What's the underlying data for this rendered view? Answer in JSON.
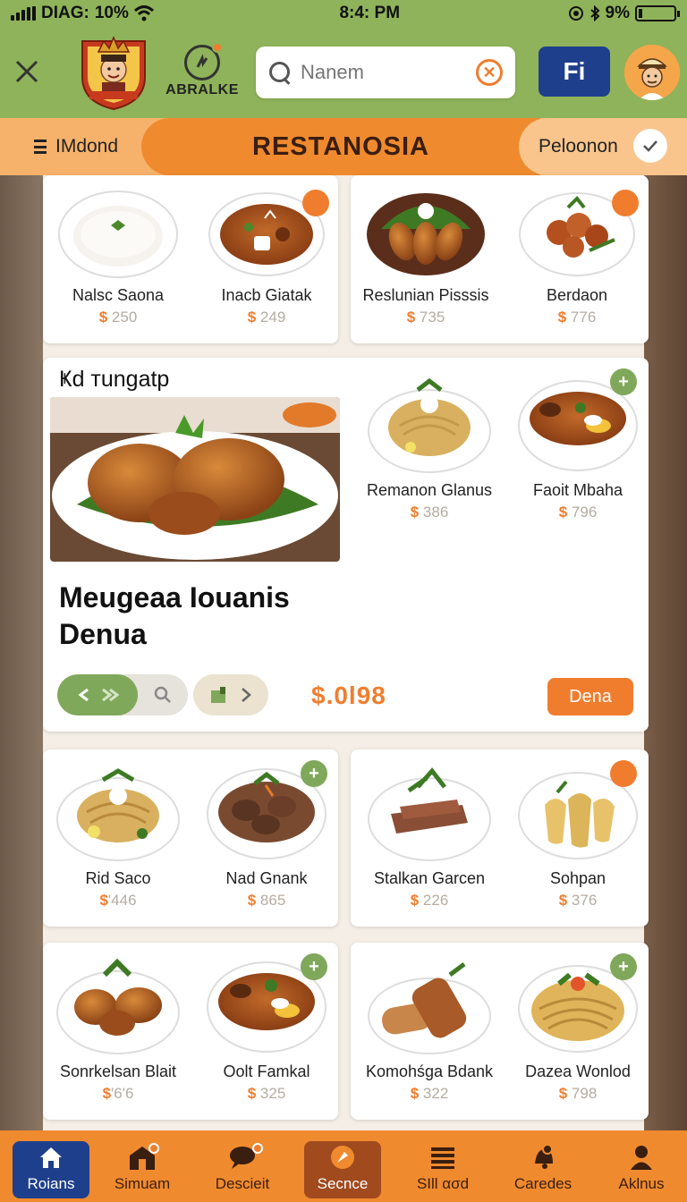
{
  "status_bar": {
    "carrier": "DIAG:",
    "signal_percent": "10%",
    "time": "8:4: PM",
    "battery": "9%"
  },
  "header": {
    "brand_name": "ABRALKE",
    "search": {
      "placeholder": "Nanem",
      "value": ""
    },
    "fi_button": "Fi"
  },
  "titlebar": {
    "menu_label": "IMdond",
    "title": "RESTANOSIA",
    "location_label": "Peloonon"
  },
  "top_row": [
    {
      "name": "Nalsc Saona",
      "currency": "$",
      "price": "250"
    },
    {
      "name": "Inacb Giatak",
      "currency": "$",
      "price": "249"
    },
    {
      "name": "Reslunian Pisssis",
      "currency": "$",
      "price": "735"
    },
    {
      "name": "Berdaon",
      "currency": "$",
      "price": "776"
    }
  ],
  "featured": {
    "label": "Ҝd тungatp",
    "title_line1": "Meugeaa Iouanis",
    "title_line2": "Denua",
    "price": "$.0l98",
    "order_button": "Dena",
    "side_dishes": [
      {
        "name": "Remanon Glanus",
        "currency": "$",
        "price": "386"
      },
      {
        "name": "Faoit Mbaha",
        "currency": "$",
        "price": "796"
      }
    ]
  },
  "row_three": [
    {
      "name": "Rid Saco",
      "currency": "$",
      "price": "'446"
    },
    {
      "name": "Nad Gnank",
      "currency": "$",
      "price": "865"
    },
    {
      "name": "Stalkan Garcen",
      "currency": "$",
      "price": "226"
    },
    {
      "name": "Sohpan",
      "currency": "$",
      "price": "376"
    }
  ],
  "row_four": [
    {
      "name": "Sonrkelsan Blait",
      "currency": "$",
      "price": "'6'6"
    },
    {
      "name": "Oolt Famkal",
      "currency": "$",
      "price": "325"
    },
    {
      "name": "Komohśga Bdank",
      "currency": "$",
      "price": "322"
    },
    {
      "name": "Dazea Wonlod",
      "currency": "$",
      "price": "798"
    }
  ],
  "bottom_nav": [
    {
      "label": "Roians",
      "icon": "home-icon"
    },
    {
      "label": "Simuam",
      "icon": "store-icon"
    },
    {
      "label": "Descieit",
      "icon": "chat-icon"
    },
    {
      "label": "Secnce",
      "icon": "compass-icon"
    },
    {
      "label": "SIll ασd",
      "icon": "list-icon"
    },
    {
      "label": "Caredes",
      "icon": "bell-icon"
    },
    {
      "label": "Aklnus",
      "icon": "user-icon"
    }
  ],
  "colors": {
    "header_green": "#8fb35a",
    "accent_orange": "#f07d2e",
    "navy": "#1e3f8c",
    "card_bg": "#ffffff"
  }
}
